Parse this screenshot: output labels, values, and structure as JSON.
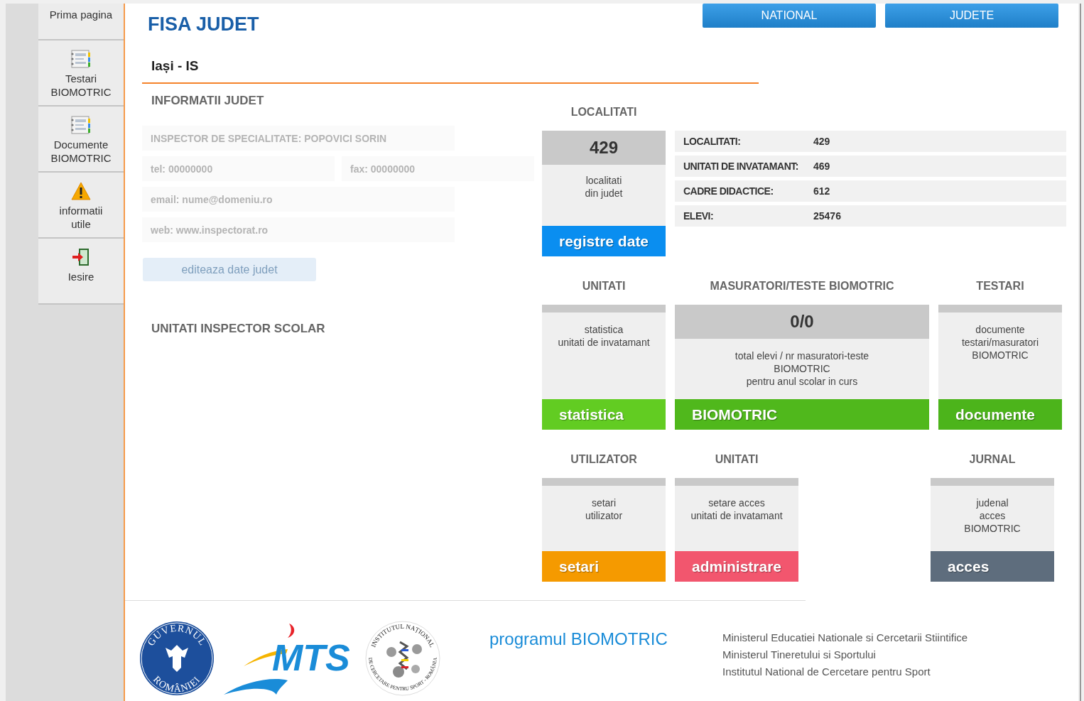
{
  "sidebar": {
    "items": [
      {
        "kind": "plain",
        "lines": [
          "Prima pagina"
        ]
      },
      {
        "kind": "notebook",
        "lines": [
          "Testari",
          "BIOMOTRIC"
        ]
      },
      {
        "kind": "notebook",
        "lines": [
          "Documente",
          "BIOMOTRIC"
        ]
      },
      {
        "kind": "warning",
        "lines": [
          "informatii",
          "utile"
        ]
      },
      {
        "kind": "exit",
        "lines": [
          "Iesire"
        ]
      }
    ]
  },
  "page_title": "FISA JUDET",
  "top_buttons": [
    "NATIONAL",
    "JUDETE"
  ],
  "county": "Iași - IS",
  "info_heading": "INFORMATII JUDET",
  "info_fields": [
    [
      {
        "text": "INSPECTOR DE SPECIALITATE: POPOVICI SORIN"
      }
    ],
    [
      {
        "text": "tel: 00000000"
      },
      {
        "text": "fax: 00000000"
      }
    ],
    [
      {
        "text": "email: nume@domeniu.ro"
      }
    ],
    [
      {
        "text": "web: www.inspectorat.ro"
      }
    ]
  ],
  "edit_button": "editeaza date judet",
  "inspector_heading": "UNITATI INSPECTOR SCOLAR",
  "stats": [
    {
      "label": "LOCALITATI:",
      "value": "429"
    },
    {
      "label": "UNITATI DE INVATAMANT:",
      "value": "469"
    },
    {
      "label": "CADRE DIDACTICE:",
      "value": "612"
    },
    {
      "label": "ELEVI:",
      "value": "25476"
    }
  ],
  "tile_rows": [
    [
      {
        "heading": "LOCALITATI",
        "value": "429",
        "description": [
          "localitati",
          "din judet"
        ],
        "button": "registre date",
        "color": "#0a8ef0"
      }
    ],
    [
      {
        "heading": "UNITATI",
        "description": [
          "statistica",
          "unitati de invatamant"
        ],
        "button": "statistica",
        "color": "#62cc22"
      },
      {
        "heading": "MASURATORI/TESTE BIOMOTRIC",
        "value": "0/0",
        "description": [
          "total elevi / nr masuratori-teste",
          "BIOMOTRIC",
          "pentru anul scolar in curs"
        ],
        "button": "BIOMOTRIC",
        "color": "#50b81c"
      },
      {
        "heading": "TESTARI",
        "description": [
          "documente",
          "testari/masuratori",
          "BIOMOTRIC"
        ],
        "button": "documente",
        "color": "#4cb41b"
      }
    ],
    [
      {
        "heading": "UTILIZATOR",
        "description": [
          "setari",
          "utilizator"
        ],
        "button": "setari",
        "color": "#f59a00"
      },
      {
        "heading": "UNITATI",
        "description": [
          "setare acces",
          "unitati de invatamant"
        ],
        "button": "administrare",
        "color": "#f2566e"
      },
      {
        "heading": "JURNAL",
        "description": [
          "judenal",
          "acces",
          "BIOMOTRIC"
        ],
        "button": "acces",
        "color": "#5e6d7d"
      }
    ]
  ],
  "footer": {
    "logos": [
      {
        "kind": "seal",
        "texts": [
          "GUVERNUL",
          "ROMÂNIEI"
        ]
      },
      {
        "kind": "mts",
        "texts": [
          "MTS"
        ]
      },
      {
        "kind": "institute",
        "texts": [
          "INSTITUTUL NAȚIONAL",
          "DE CERCETARE PENTRU SPORT - ROMÂNIA"
        ]
      }
    ],
    "program": "programul BIOMOTRIC",
    "institutions": [
      "Ministerul Educatiei Nationale si Cercetarii Stiintifice",
      "Ministerul Tineretului si Sportului",
      "Institutul National de Cercetare pentru Sport"
    ]
  }
}
